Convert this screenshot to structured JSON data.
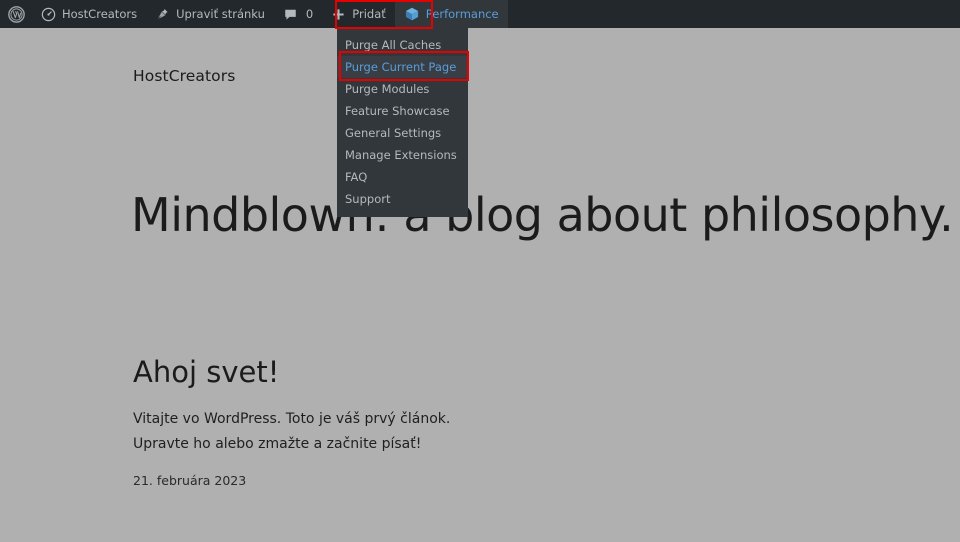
{
  "adminbar": {
    "wp_logo_icon": "wordpress-logo-icon",
    "items": [
      {
        "icon": "dashboard-speedometer-icon",
        "label": "HostCreators",
        "name": "adminbar-site-name"
      },
      {
        "icon": "edit-pin-icon",
        "label": "Upraviť stránku",
        "name": "adminbar-edit-page"
      },
      {
        "icon": "comment-bubble-icon",
        "label": "",
        "count": "0",
        "name": "adminbar-comments"
      },
      {
        "icon": "plus-icon",
        "label": "Pridať",
        "name": "adminbar-new-content"
      },
      {
        "icon": "w3-total-cache-cube-icon",
        "label": "Performance",
        "name": "adminbar-performance"
      }
    ]
  },
  "dropdown": {
    "owner": "Performance",
    "items": [
      {
        "label": "Purge All Caches",
        "highlighted": false
      },
      {
        "label": "Purge Current Page",
        "highlighted": true
      },
      {
        "label": "Purge Modules",
        "highlighted": false
      },
      {
        "label": "Feature Showcase",
        "highlighted": false
      },
      {
        "label": "General Settings",
        "highlighted": false
      },
      {
        "label": "Manage Extensions",
        "highlighted": false
      },
      {
        "label": "FAQ",
        "highlighted": false
      },
      {
        "label": "Support",
        "highlighted": false
      }
    ]
  },
  "annotations": {
    "color": "#e60000",
    "targets": [
      "Performance",
      "Purge Current Page"
    ]
  },
  "site": {
    "title": "HostCreators",
    "hero_heading": "Mindblown: a blog about philosophy.",
    "post": {
      "title": "Ahoj svet!",
      "line1": "Vitajte vo WordPress. Toto je váš prvý článok.",
      "line2": "Upravte ho alebo zmažte a začnite písať!",
      "date": "21. februára 2023"
    }
  },
  "colors": {
    "adminbar_bg": "#23282d",
    "dropdown_bg": "#32373c",
    "menu_text": "#b4b9be",
    "accent_blue": "#5b9dd9",
    "page_bg": "#b0b0b0",
    "annotation_red": "#e60000"
  }
}
